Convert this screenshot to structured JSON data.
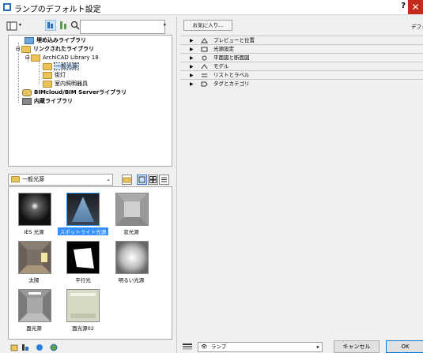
{
  "window": {
    "title": "ランプのデフォルト設定",
    "help": "?",
    "close": "✕"
  },
  "search": {
    "placeholder": ""
  },
  "tree": {
    "items": [
      {
        "label": "埋め込みライブラリ"
      },
      {
        "label": "リンクされたライブラリ"
      },
      {
        "label": "ArchiCAD Library 18"
      },
      {
        "label": "一般光源"
      },
      {
        "label": "街灯"
      },
      {
        "label": "室内照明器具"
      },
      {
        "label": "BIMcloud/BIM Serverライブラリ"
      },
      {
        "label": "内蔵ライブラリ"
      }
    ]
  },
  "folder_select": {
    "value": "一般光源"
  },
  "thumbnails": [
    {
      "label": "IES 光源"
    },
    {
      "label": "スポットライト光源"
    },
    {
      "label": "窓光源"
    },
    {
      "label": "太陽"
    },
    {
      "label": "平行光"
    },
    {
      "label": "明るい光源"
    },
    {
      "label": "面光源"
    },
    {
      "label": "面光源02"
    }
  ],
  "right": {
    "favorites_label": "お気に入り...",
    "header_label": "デフォ",
    "sections": [
      {
        "label": "プレビューと位置"
      },
      {
        "label": "光源設定"
      },
      {
        "label": "平面図と断面図"
      },
      {
        "label": "モデル"
      },
      {
        "label": "リストとラベル"
      },
      {
        "label": "タグとカテゴリ"
      }
    ]
  },
  "bottom": {
    "layer_value": "ランプ",
    "cancel_label": "キャンセル",
    "ok_label": "OK"
  }
}
